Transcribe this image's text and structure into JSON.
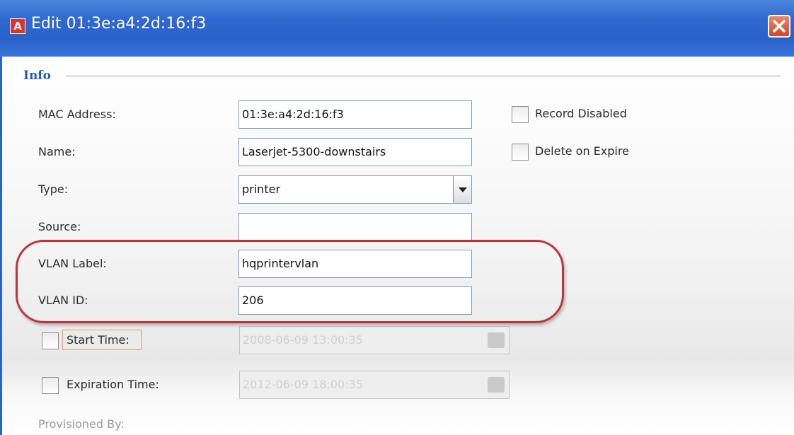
{
  "window": {
    "title": "Edit 01:3e:a4:2d:16:f3",
    "app_icon_letter": "A",
    "app_icon": "app-logo-icon",
    "close_icon": "close-icon",
    "titlebar_color": "#2f68cf",
    "close_color": "#d2452c"
  },
  "section": {
    "title": "Info",
    "title_color": "#2559c0"
  },
  "fields": {
    "mac_address": {
      "label": "MAC Address:",
      "value": "01:3e:a4:2d:16:f3"
    },
    "name": {
      "label": "Name:",
      "value": "Laserjet-5300-downstairs"
    },
    "type": {
      "label": "Type:",
      "value": "printer"
    },
    "source": {
      "label": "Source:",
      "value": ""
    },
    "vlan_label": {
      "label": "VLAN Label:",
      "value": "hqprintervlan"
    },
    "vlan_id": {
      "label": "VLAN ID:",
      "value": "206"
    },
    "start_time": {
      "label": "Start Time:",
      "value": "2008-06-09 13:00:35",
      "checked": false
    },
    "expiration_time": {
      "label": "Expiration Time:",
      "value": "2012-06-09 18:00:35",
      "checked": false
    },
    "provisioned_by": {
      "label": "Provisioned By:"
    }
  },
  "options": {
    "record_disabled": {
      "label": "Record Disabled",
      "checked": false
    },
    "delete_on_expire": {
      "label": "Delete on Expire",
      "checked": false
    }
  },
  "annotation": {
    "highlight_color": "#c0323a"
  }
}
